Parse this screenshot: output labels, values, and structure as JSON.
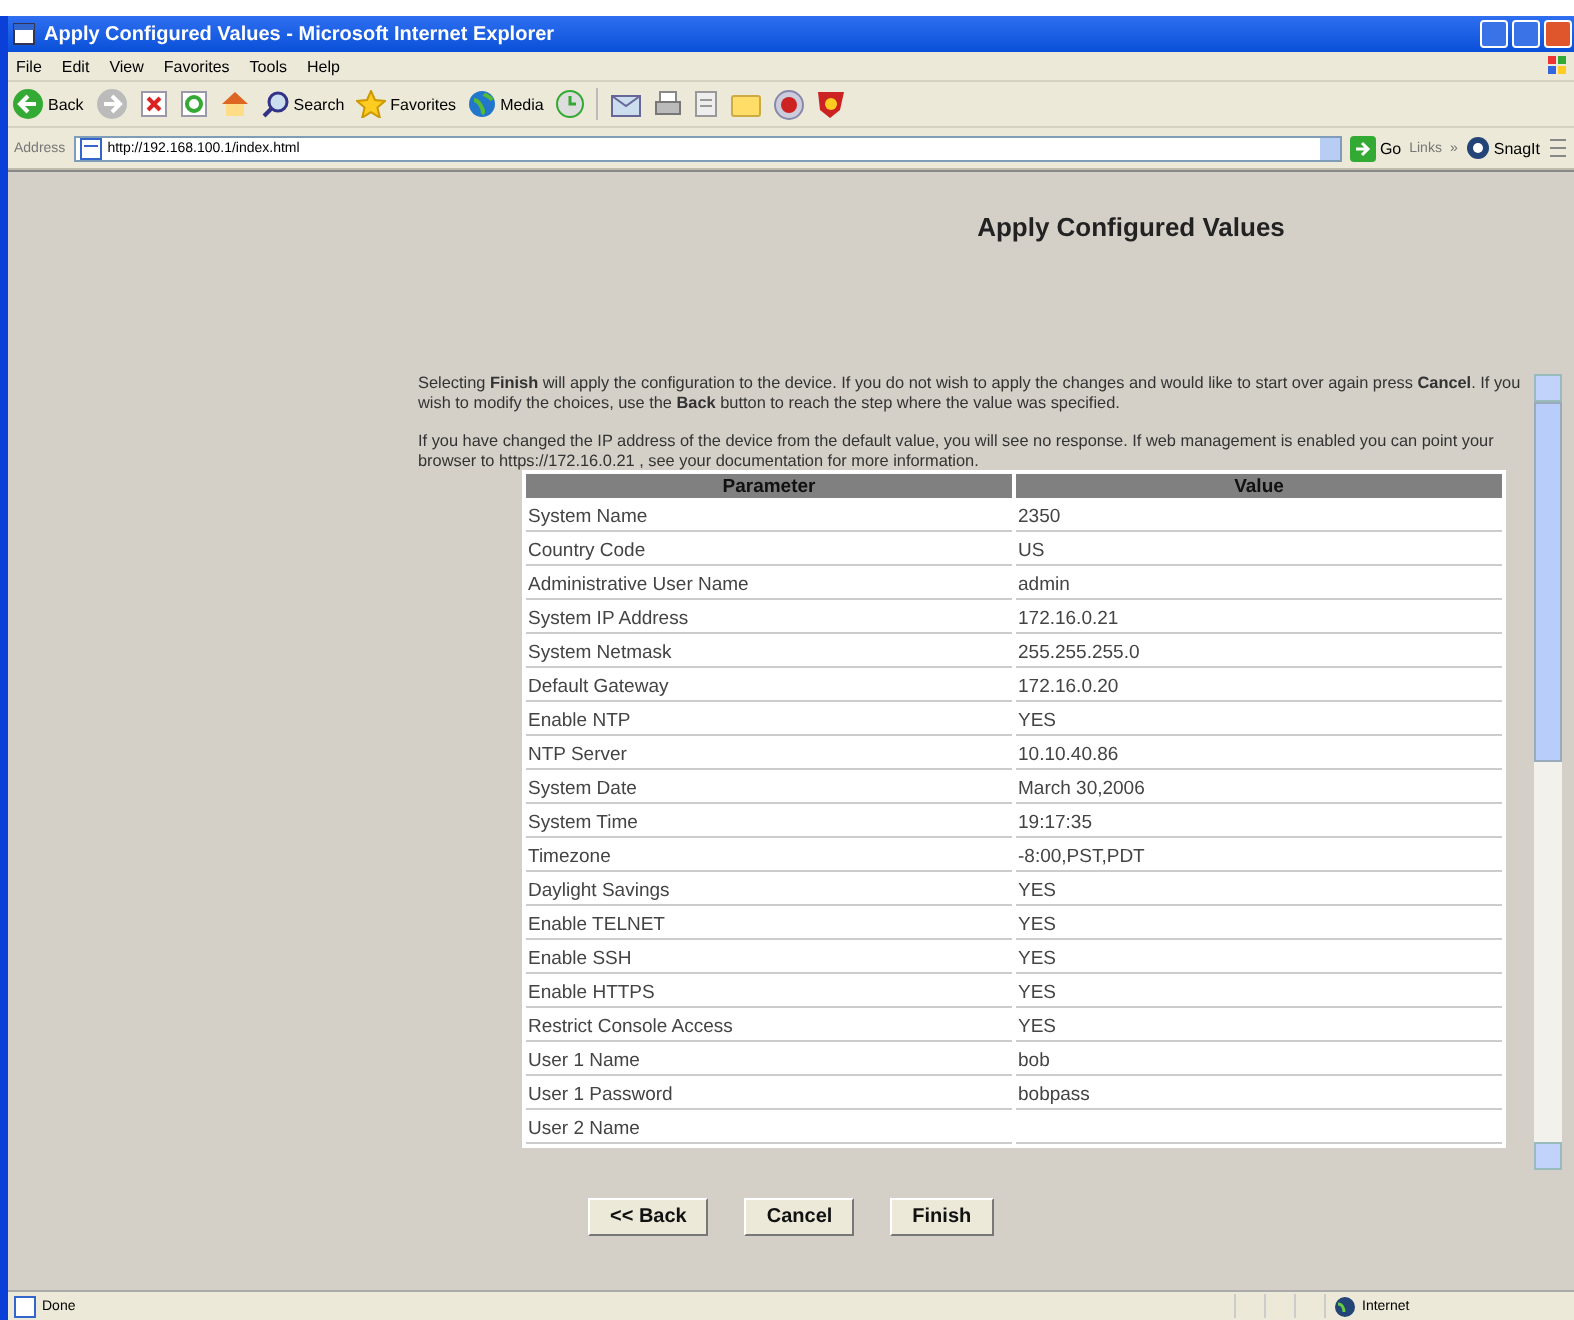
{
  "window": {
    "title": "Apply Configured Values - Microsoft Internet Explorer"
  },
  "menu": [
    "File",
    "Edit",
    "View",
    "Favorites",
    "Tools",
    "Help"
  ],
  "toolbar": {
    "back": "Back",
    "search": "Search",
    "favorites": "Favorites",
    "media": "Media"
  },
  "address_bar": {
    "label": "Address",
    "value": "http://192.168.100.1/index.html",
    "go": "Go",
    "links": "Links",
    "chevron": "»",
    "snagit": "SnagIt"
  },
  "page": {
    "heading": "Apply Configured Values",
    "paragraphs": [
      "Selecting **Finish** will apply the configuration to the device. If you do not wish to apply the changes and would like to start over again press **Cancel**. If you wish to modify the choices, use the **Back** button to reach the step where the value was specified.",
      "If you have changed the IP address of the device from the default value, you will see no response. If web management is enabled you can point your browser to https://172.16.0.21 , see your documentation for more information."
    ],
    "table": {
      "columns": [
        "Parameter",
        "Value"
      ],
      "rows": [
        [
          "System Name",
          "2350"
        ],
        [
          "Country Code",
          "US"
        ],
        [
          "Administrative User Name",
          "admin"
        ],
        [
          "System IP Address",
          "172.16.0.21"
        ],
        [
          "System Netmask",
          "255.255.255.0"
        ],
        [
          "Default Gateway",
          "172.16.0.20"
        ],
        [
          "Enable NTP",
          "YES"
        ],
        [
          "NTP Server",
          "10.10.40.86"
        ],
        [
          "System Date",
          "March 30,2006"
        ],
        [
          "System Time",
          "19:17:35"
        ],
        [
          "Timezone",
          "-8:00,PST,PDT"
        ],
        [
          "Daylight Savings",
          "YES"
        ],
        [
          "Enable TELNET",
          "YES"
        ],
        [
          "Enable SSH",
          "YES"
        ],
        [
          "Enable HTTPS",
          "YES"
        ],
        [
          "Restrict Console Access",
          "YES"
        ],
        [
          "User 1 Name",
          "bob"
        ],
        [
          "User 1 Password",
          "bobpass"
        ],
        [
          "User 2 Name",
          ""
        ]
      ]
    },
    "buttons": [
      "<< Back",
      "Cancel",
      "Finish"
    ]
  },
  "status_bar": {
    "text": "Done",
    "zone": "Internet"
  }
}
